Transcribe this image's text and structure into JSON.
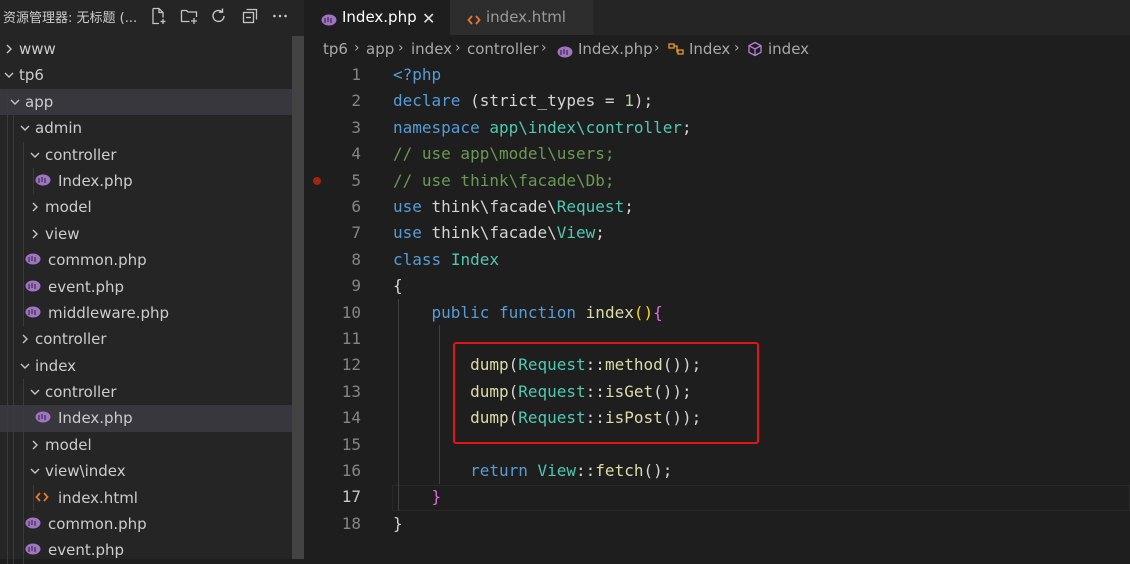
{
  "sidebar": {
    "title": "资源管理器: 无标题 (...",
    "actions": [
      "new-file-icon",
      "new-folder-icon",
      "refresh-icon",
      "collapse-all-icon",
      "more-icon"
    ],
    "tree": [
      {
        "label": "www",
        "kind": "folder",
        "open": false,
        "depth": 0
      },
      {
        "label": "tp6",
        "kind": "folder",
        "open": true,
        "depth": 0
      },
      {
        "label": "app",
        "kind": "folder",
        "open": true,
        "depth": 1,
        "hl": true
      },
      {
        "label": "admin",
        "kind": "folder",
        "open": true,
        "depth": 2
      },
      {
        "label": "controller",
        "kind": "folder",
        "open": true,
        "depth": 3
      },
      {
        "label": "Index.php",
        "kind": "php",
        "depth": 4
      },
      {
        "label": "model",
        "kind": "folder",
        "open": false,
        "depth": 3
      },
      {
        "label": "view",
        "kind": "folder",
        "open": false,
        "depth": 3
      },
      {
        "label": "common.php",
        "kind": "php",
        "depth": 3
      },
      {
        "label": "event.php",
        "kind": "php",
        "depth": 3
      },
      {
        "label": "middleware.php",
        "kind": "php",
        "depth": 3
      },
      {
        "label": "controller",
        "kind": "folder",
        "open": false,
        "depth": 2
      },
      {
        "label": "index",
        "kind": "folder",
        "open": true,
        "depth": 2
      },
      {
        "label": "controller",
        "kind": "folder",
        "open": true,
        "depth": 3
      },
      {
        "label": "Index.php",
        "kind": "php",
        "depth": 4,
        "hl": true
      },
      {
        "label": "model",
        "kind": "folder",
        "open": false,
        "depth": 3
      },
      {
        "label": "view\\index",
        "kind": "folder",
        "open": true,
        "depth": 3
      },
      {
        "label": "index.html",
        "kind": "html",
        "depth": 4
      },
      {
        "label": "common.php",
        "kind": "php",
        "depth": 3
      },
      {
        "label": "event.php",
        "kind": "php",
        "depth": 3
      }
    ]
  },
  "tabs": [
    {
      "label": "Index.php",
      "icon": "php-icon",
      "active": true,
      "close": "✕"
    },
    {
      "label": "index.html",
      "icon": "html-icon",
      "active": false
    }
  ],
  "breadcrumbs": [
    "tp6",
    "app",
    "index",
    "controller",
    "Index.php",
    "Index",
    "index"
  ],
  "code": {
    "active_line": 17,
    "breakpoint_line": 5,
    "lines": [
      {
        "n": "1",
        "tokens": [
          [
            "ph",
            "<?php"
          ]
        ]
      },
      {
        "n": "2",
        "tokens": [
          [
            "k",
            "declare"
          ],
          [
            "pu",
            " (strict_types = "
          ],
          [
            "nm",
            "1"
          ],
          [
            "pu",
            ");"
          ]
        ]
      },
      {
        "n": "3",
        "tokens": [
          [
            "k",
            "namespace"
          ],
          [
            "pu",
            " "
          ],
          [
            "ty",
            "app\\index\\controller"
          ],
          [
            "pu",
            ";"
          ]
        ]
      },
      {
        "n": "4",
        "tokens": [
          [
            "cm",
            "// use app\\model\\users;"
          ]
        ]
      },
      {
        "n": "5",
        "tokens": [
          [
            "cm",
            "// use think\\facade\\Db;"
          ]
        ]
      },
      {
        "n": "6",
        "tokens": [
          [
            "k",
            "use"
          ],
          [
            "pu",
            " think\\facade\\"
          ],
          [
            "ty",
            "Request"
          ],
          [
            "pu",
            ";"
          ]
        ]
      },
      {
        "n": "7",
        "tokens": [
          [
            "k",
            "use"
          ],
          [
            "pu",
            " think\\facade\\"
          ],
          [
            "ty",
            "View"
          ],
          [
            "pu",
            ";"
          ]
        ]
      },
      {
        "n": "8",
        "tokens": [
          [
            "k",
            "class"
          ],
          [
            "pu",
            " "
          ],
          [
            "ty",
            "Index"
          ]
        ]
      },
      {
        "n": "9",
        "tokens": [
          [
            "pu",
            "{"
          ]
        ]
      },
      {
        "n": "10",
        "tokens": [
          [
            "pu",
            "    "
          ],
          [
            "k",
            "public"
          ],
          [
            "pu",
            " "
          ],
          [
            "k",
            "function"
          ],
          [
            "pu",
            " "
          ],
          [
            "fn",
            "index"
          ],
          [
            "bm",
            "()"
          ],
          [
            "bm2",
            "{"
          ]
        ]
      },
      {
        "n": "11",
        "tokens": []
      },
      {
        "n": "12",
        "tokens": [
          [
            "pu",
            "        "
          ],
          [
            "fn",
            "dump"
          ],
          [
            "pu",
            "("
          ],
          [
            "ty",
            "Request"
          ],
          [
            "pu",
            "::"
          ],
          [
            "fn",
            "method"
          ],
          [
            "pu",
            "());"
          ]
        ]
      },
      {
        "n": "13",
        "tokens": [
          [
            "pu",
            "        "
          ],
          [
            "fn",
            "dump"
          ],
          [
            "pu",
            "("
          ],
          [
            "ty",
            "Request"
          ],
          [
            "pu",
            "::"
          ],
          [
            "fn",
            "isGet"
          ],
          [
            "pu",
            "());"
          ]
        ]
      },
      {
        "n": "14",
        "tokens": [
          [
            "pu",
            "        "
          ],
          [
            "fn",
            "dump"
          ],
          [
            "pu",
            "("
          ],
          [
            "ty",
            "Request"
          ],
          [
            "pu",
            "::"
          ],
          [
            "fn",
            "isPost"
          ],
          [
            "pu",
            "());"
          ]
        ]
      },
      {
        "n": "15",
        "tokens": []
      },
      {
        "n": "16",
        "tokens": [
          [
            "pu",
            "        "
          ],
          [
            "k",
            "return"
          ],
          [
            "pu",
            " "
          ],
          [
            "ty",
            "View"
          ],
          [
            "pu",
            "::"
          ],
          [
            "fn",
            "fetch"
          ],
          [
            "pu",
            "();"
          ]
        ]
      },
      {
        "n": "17",
        "tokens": [
          [
            "pu",
            "    "
          ],
          [
            "bm2",
            "}"
          ]
        ]
      },
      {
        "n": "18",
        "tokens": [
          [
            "pu",
            "}"
          ]
        ]
      }
    ]
  },
  "colors": {
    "bg": "#1e1e1e",
    "sidebar": "#252526",
    "keyword": "#569cd6",
    "type": "#4ec9b0",
    "function": "#dcdcaa",
    "comment": "#6a9955",
    "number": "#b5cea8",
    "highlight_box": "#e31414",
    "php_icon": "#a074c4",
    "html_icon": "#e37933"
  }
}
